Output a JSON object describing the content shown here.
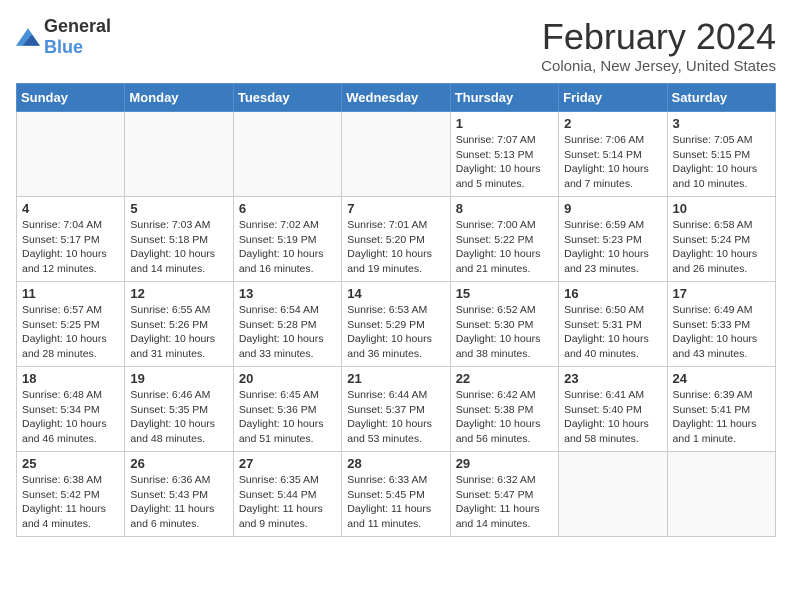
{
  "logo": {
    "general": "General",
    "blue": "Blue"
  },
  "title": "February 2024",
  "location": "Colonia, New Jersey, United States",
  "days_of_week": [
    "Sunday",
    "Monday",
    "Tuesday",
    "Wednesday",
    "Thursday",
    "Friday",
    "Saturday"
  ],
  "weeks": [
    [
      {
        "day": "",
        "info": ""
      },
      {
        "day": "",
        "info": ""
      },
      {
        "day": "",
        "info": ""
      },
      {
        "day": "",
        "info": ""
      },
      {
        "day": "1",
        "info": "Sunrise: 7:07 AM\nSunset: 5:13 PM\nDaylight: 10 hours and 5 minutes."
      },
      {
        "day": "2",
        "info": "Sunrise: 7:06 AM\nSunset: 5:14 PM\nDaylight: 10 hours and 7 minutes."
      },
      {
        "day": "3",
        "info": "Sunrise: 7:05 AM\nSunset: 5:15 PM\nDaylight: 10 hours and 10 minutes."
      }
    ],
    [
      {
        "day": "4",
        "info": "Sunrise: 7:04 AM\nSunset: 5:17 PM\nDaylight: 10 hours and 12 minutes."
      },
      {
        "day": "5",
        "info": "Sunrise: 7:03 AM\nSunset: 5:18 PM\nDaylight: 10 hours and 14 minutes."
      },
      {
        "day": "6",
        "info": "Sunrise: 7:02 AM\nSunset: 5:19 PM\nDaylight: 10 hours and 16 minutes."
      },
      {
        "day": "7",
        "info": "Sunrise: 7:01 AM\nSunset: 5:20 PM\nDaylight: 10 hours and 19 minutes."
      },
      {
        "day": "8",
        "info": "Sunrise: 7:00 AM\nSunset: 5:22 PM\nDaylight: 10 hours and 21 minutes."
      },
      {
        "day": "9",
        "info": "Sunrise: 6:59 AM\nSunset: 5:23 PM\nDaylight: 10 hours and 23 minutes."
      },
      {
        "day": "10",
        "info": "Sunrise: 6:58 AM\nSunset: 5:24 PM\nDaylight: 10 hours and 26 minutes."
      }
    ],
    [
      {
        "day": "11",
        "info": "Sunrise: 6:57 AM\nSunset: 5:25 PM\nDaylight: 10 hours and 28 minutes."
      },
      {
        "day": "12",
        "info": "Sunrise: 6:55 AM\nSunset: 5:26 PM\nDaylight: 10 hours and 31 minutes."
      },
      {
        "day": "13",
        "info": "Sunrise: 6:54 AM\nSunset: 5:28 PM\nDaylight: 10 hours and 33 minutes."
      },
      {
        "day": "14",
        "info": "Sunrise: 6:53 AM\nSunset: 5:29 PM\nDaylight: 10 hours and 36 minutes."
      },
      {
        "day": "15",
        "info": "Sunrise: 6:52 AM\nSunset: 5:30 PM\nDaylight: 10 hours and 38 minutes."
      },
      {
        "day": "16",
        "info": "Sunrise: 6:50 AM\nSunset: 5:31 PM\nDaylight: 10 hours and 40 minutes."
      },
      {
        "day": "17",
        "info": "Sunrise: 6:49 AM\nSunset: 5:33 PM\nDaylight: 10 hours and 43 minutes."
      }
    ],
    [
      {
        "day": "18",
        "info": "Sunrise: 6:48 AM\nSunset: 5:34 PM\nDaylight: 10 hours and 46 minutes."
      },
      {
        "day": "19",
        "info": "Sunrise: 6:46 AM\nSunset: 5:35 PM\nDaylight: 10 hours and 48 minutes."
      },
      {
        "day": "20",
        "info": "Sunrise: 6:45 AM\nSunset: 5:36 PM\nDaylight: 10 hours and 51 minutes."
      },
      {
        "day": "21",
        "info": "Sunrise: 6:44 AM\nSunset: 5:37 PM\nDaylight: 10 hours and 53 minutes."
      },
      {
        "day": "22",
        "info": "Sunrise: 6:42 AM\nSunset: 5:38 PM\nDaylight: 10 hours and 56 minutes."
      },
      {
        "day": "23",
        "info": "Sunrise: 6:41 AM\nSunset: 5:40 PM\nDaylight: 10 hours and 58 minutes."
      },
      {
        "day": "24",
        "info": "Sunrise: 6:39 AM\nSunset: 5:41 PM\nDaylight: 11 hours and 1 minute."
      }
    ],
    [
      {
        "day": "25",
        "info": "Sunrise: 6:38 AM\nSunset: 5:42 PM\nDaylight: 11 hours and 4 minutes."
      },
      {
        "day": "26",
        "info": "Sunrise: 6:36 AM\nSunset: 5:43 PM\nDaylight: 11 hours and 6 minutes."
      },
      {
        "day": "27",
        "info": "Sunrise: 6:35 AM\nSunset: 5:44 PM\nDaylight: 11 hours and 9 minutes."
      },
      {
        "day": "28",
        "info": "Sunrise: 6:33 AM\nSunset: 5:45 PM\nDaylight: 11 hours and 11 minutes."
      },
      {
        "day": "29",
        "info": "Sunrise: 6:32 AM\nSunset: 5:47 PM\nDaylight: 11 hours and 14 minutes."
      },
      {
        "day": "",
        "info": ""
      },
      {
        "day": "",
        "info": ""
      }
    ]
  ]
}
